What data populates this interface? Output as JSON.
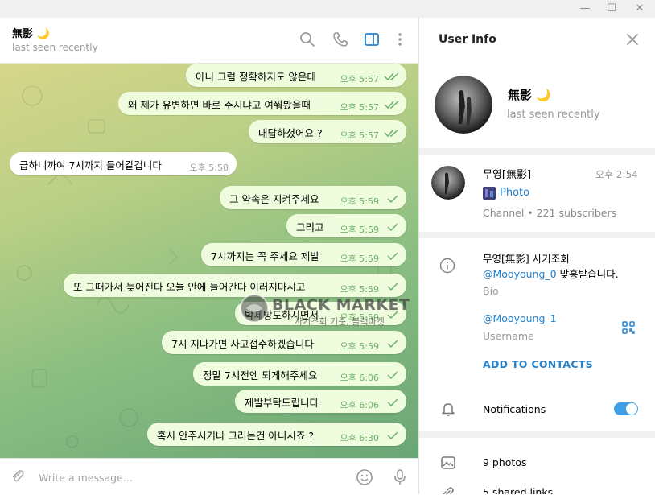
{
  "window": {
    "minimize": "—",
    "maximize": "☐",
    "close": "✕"
  },
  "chat_header": {
    "name": "無影 🌙",
    "status": "last seen recently"
  },
  "messages": [
    {
      "text": "아니 그럼 정확하지도 않은데",
      "time": "오후 5:57",
      "dir": "out",
      "read": true
    },
    {
      "text": "왜 제가 유변하면 바로 주시냐고 여쭤봤을때",
      "time": "오후 5:57",
      "dir": "out",
      "read": true
    },
    {
      "text": "대답하셨어요 ?",
      "time": "오후 5:57",
      "dir": "out",
      "read": true
    },
    {
      "text": "급하니까여 7시까지 들어갈겁니다",
      "time": "오후 5:58",
      "dir": "in",
      "read": false
    },
    {
      "text": "그 약속은 지켜주세요",
      "time": "오후 5:59",
      "dir": "out",
      "read": false
    },
    {
      "text": "그리고",
      "time": "오후 5:59",
      "dir": "out",
      "read": false
    },
    {
      "text": "7시까지는 꼭 주세요 제발",
      "time": "오후 5:59",
      "dir": "out",
      "read": false
    },
    {
      "text": "또 그때가서 늦어진다 오늘 안에 들어간다 이러지마시고",
      "time": "오후 5:59",
      "dir": "out",
      "read": false
    },
    {
      "text": "박제방도하시면서",
      "time": "오후 5:59",
      "dir": "out",
      "read": false
    },
    {
      "text": "7시 지나가면 사고접수하겠습니다",
      "time": "오후 5:59",
      "dir": "out",
      "read": false
    },
    {
      "text": "정말 7시전엔 되게해주세요",
      "time": "오후 6:06",
      "dir": "out",
      "read": false
    },
    {
      "text": "제발부탁드립니다",
      "time": "오후 6:06",
      "dir": "out",
      "read": false
    },
    {
      "text": "혹시 안주시거나 그러는건 아니시죠 ?",
      "time": "오후 6:30",
      "dir": "out",
      "read": false
    }
  ],
  "watermark": {
    "brand": "BLACK MARKET",
    "sub": "사기조회 기준, 블랙마켓"
  },
  "composer": {
    "placeholder": "Write a message..."
  },
  "user_info": {
    "title": "User Info",
    "name": "無影 🌙",
    "status": "last seen recently",
    "channel": {
      "name": "무영[無影]",
      "time": "오후 2:54",
      "last_message": "Photo",
      "meta": "Channel • 221 subscribers"
    },
    "bio": {
      "line1": "무영[無影] 사기조회",
      "handle": "@Mooyoung_0",
      "line2_suffix": " 맞홍받습니다.",
      "label": "Bio"
    },
    "username": {
      "value": "@Mooyoung_1",
      "label": "Username"
    },
    "add_contacts": "ADD TO CONTACTS",
    "notifications": {
      "label": "Notifications",
      "enabled": true
    },
    "photos": "9 photos",
    "shared_links": "5 shared links"
  },
  "colors": {
    "accent": "#2481cc",
    "outgoing_bubble": "#effdde",
    "check": "#6cae6a",
    "toggle": "#3fa0e6"
  }
}
